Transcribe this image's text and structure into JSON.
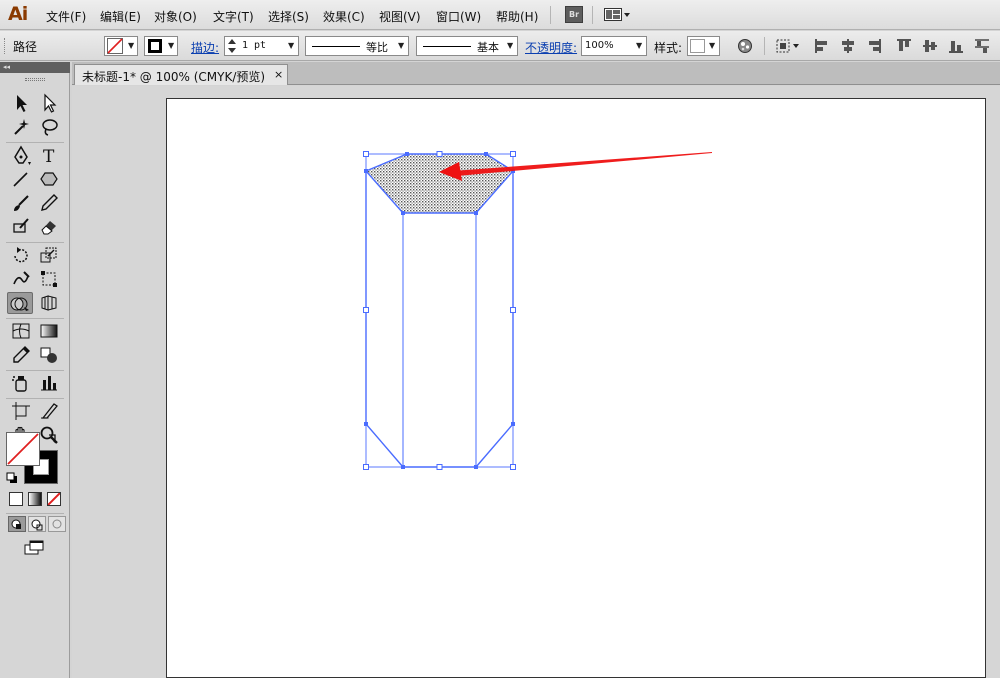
{
  "app": {
    "logo": "Ai"
  },
  "menu": {
    "file": "文件(F)",
    "edit": "编辑(E)",
    "object": "对象(O)",
    "type": "文字(T)",
    "select": "选择(S)",
    "effect": "效果(C)",
    "view": "视图(V)",
    "window": "窗口(W)",
    "help": "帮助(H)",
    "bridge": "Br"
  },
  "control": {
    "object_type": "路径",
    "stroke_label": "描边:",
    "stroke_weight": "1 pt",
    "stroke_profile": "等比",
    "brush": "基本",
    "opacity_label": "不透明度:",
    "opacity_value": "100%",
    "style_label": "样式:"
  },
  "document": {
    "tab_title": "未标题-1* @ 100% (CMYK/预览)",
    "close": "×"
  },
  "colors": {
    "selection": "#4a6cff",
    "arrow": "#ee1111",
    "fill_none_slash": "#e02020",
    "logo": "#8a3a00"
  },
  "icons": {
    "selection_tool": "selection-arrow-icon",
    "direct_selection_tool": "direct-selection-icon",
    "pen_tool": "pen-icon",
    "type_tool": "type-icon",
    "line_tool": "line-segment-icon",
    "polygon_tool": "polygon-icon",
    "paintbrush_tool": "paintbrush-icon",
    "pencil_tool": "pencil-icon",
    "eraser_tool": "eraser-icon",
    "rotate_tool": "rotate-icon",
    "scale_tool": "scale-icon",
    "hand_tool": "hand-icon",
    "zoom_tool": "zoom-icon"
  }
}
